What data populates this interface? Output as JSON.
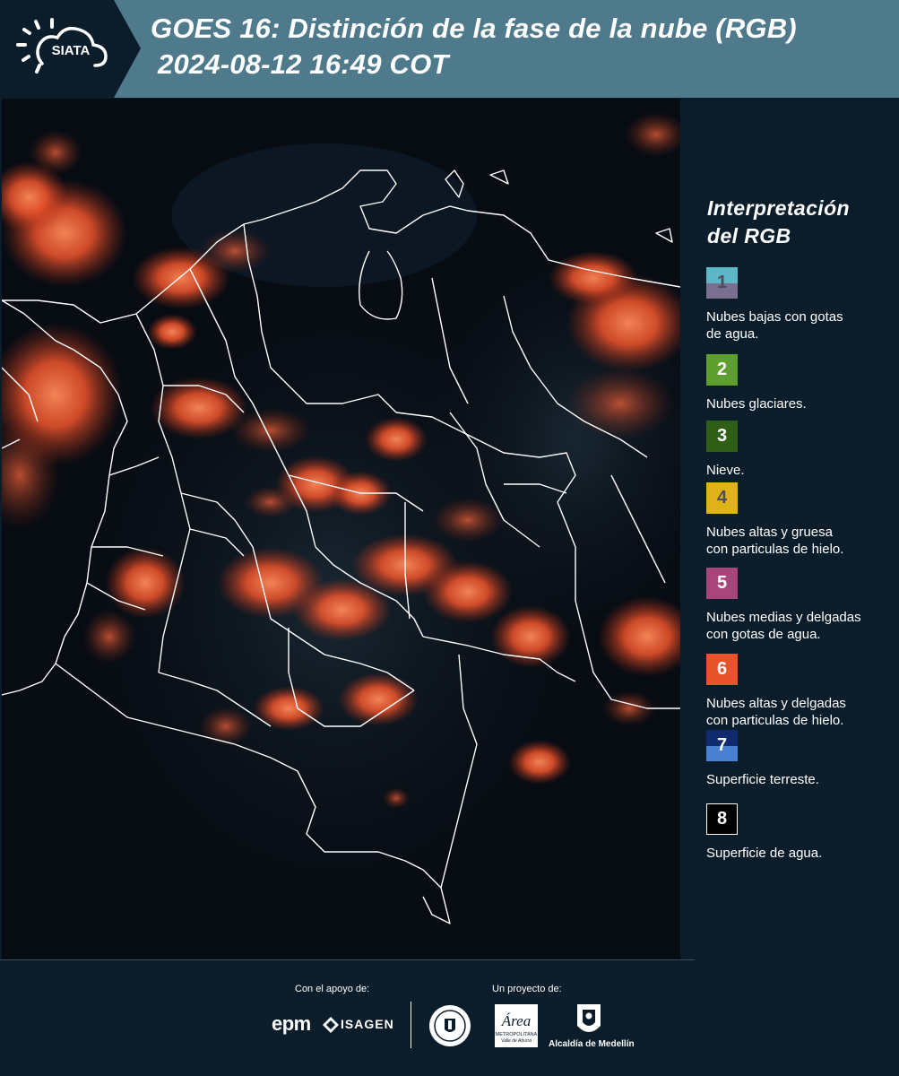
{
  "header": {
    "logo_text": "SIATA",
    "title_line1": "GOES 16: Distinción de la fase de la nube (RGB)",
    "title_line2": "2024-08-12 16:49 COT",
    "color": "#4f7a8c"
  },
  "legend": {
    "title_line1": "Interpretación",
    "title_line2": "del RGB",
    "items": [
      {
        "number": "1",
        "label_line1": "Nubes bajas con gotas",
        "label_line2": "de agua.",
        "color_top": "#5eb7c7",
        "color_bottom": "#7a6f8f",
        "number_color": "#4a4e5c"
      },
      {
        "number": "2",
        "label_line1": "Nubes glaciares.",
        "label_line2": "",
        "color_top": "#5e9e2f",
        "color_bottom": "#5e9e2f",
        "number_color": "#ffffff"
      },
      {
        "number": "3",
        "label_line1": "Nieve.",
        "label_line2": "",
        "color_top": "#2f5e17",
        "color_bottom": "#2f5e17",
        "number_color": "#ffffff"
      },
      {
        "number": "4",
        "label_line1": "Nubes altas y gruesa",
        "label_line2": "con particulas de hielo.",
        "color_top": "#e0b21a",
        "color_bottom": "#e0b21a",
        "number_color": "#4a4e5c"
      },
      {
        "number": "5",
        "label_line1": "Nubes medias y delgadas",
        "label_line2": "con gotas de agua.",
        "color_top": "#a8457a",
        "color_bottom": "#a8457a",
        "number_color": "#ffffff"
      },
      {
        "number": "6",
        "label_line1": "Nubes altas y delgadas",
        "label_line2": "con particulas de hielo.",
        "color_top": "#e9532c",
        "color_bottom": "#e9532c",
        "number_color": "#ffffff"
      },
      {
        "number": "7",
        "label_line1": "Superficie terreste.",
        "label_line2": "",
        "color_top": "#0f2a6e",
        "color_bottom": "#4a7fd1",
        "number_color": "#ffffff"
      },
      {
        "number": "8",
        "label_line1": "Superficie de agua.",
        "label_line2": "",
        "color_top": "#000000",
        "color_bottom": "#000000",
        "number_color": "#ffffff"
      }
    ]
  },
  "footer": {
    "support_caption": "Con el apoyo de:",
    "project_caption": "Un proyecto de:",
    "logo_epm": "epm",
    "logo_isagen": "ISAGEN",
    "logo_area_name": "Área",
    "logo_area_sub1": "METROPOLITANA",
    "logo_area_sub2": "Valle de Aburrá",
    "logo_alcaldia": "Alcaldía de Medellín"
  }
}
